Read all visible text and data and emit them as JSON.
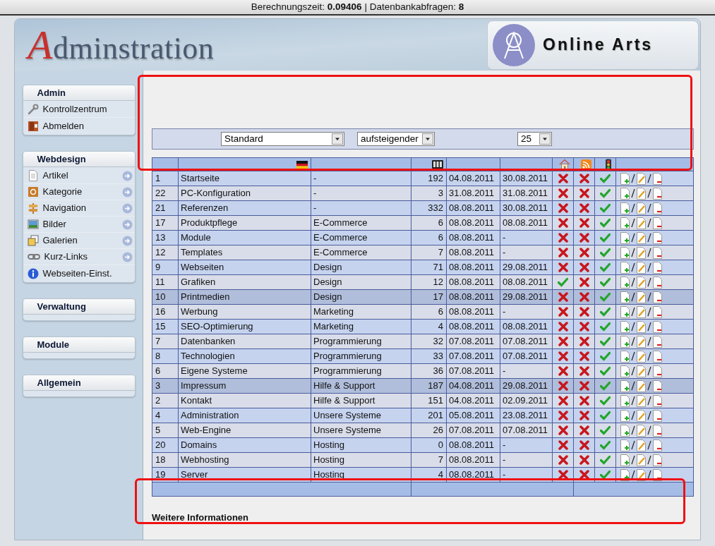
{
  "status_bar": {
    "text": "Berechnungszeit: **0.09406** | Datenbankabfragen: **8**"
  },
  "header": {
    "logo_text": "Adminstration",
    "brand": "Online Arts"
  },
  "sidebar": {
    "sections": [
      {
        "title": "Admin",
        "expanded": true,
        "items": [
          {
            "label": "Kontrollzentrum",
            "submenu": false
          },
          {
            "label": "Abmelden",
            "submenu": false
          }
        ]
      },
      {
        "title": "Webdesign",
        "expanded": true,
        "items": [
          {
            "label": "Artikel",
            "submenu": true
          },
          {
            "label": "Kategorie",
            "submenu": true
          },
          {
            "label": "Navigation",
            "submenu": true
          },
          {
            "label": "Bilder",
            "submenu": true
          },
          {
            "label": "Galerien",
            "submenu": true
          },
          {
            "label": "Kurz-Links",
            "submenu": true
          },
          {
            "label": "Webseiten-Einst.",
            "submenu": false
          }
        ]
      },
      {
        "title": "Verwaltung",
        "expanded": false
      },
      {
        "title": "Module",
        "expanded": false
      },
      {
        "title": "Allgemein",
        "expanded": false
      }
    ]
  },
  "filters": [
    {
      "value": "Standard"
    },
    {
      "value": "aufsteigender"
    },
    {
      "value": "25"
    }
  ],
  "table": {
    "rows": [
      {
        "id": "1",
        "title": "Startseite",
        "category": "-",
        "count": "192",
        "created": "04.08.2011",
        "modified": "30.08.2011",
        "home": false,
        "rss": false,
        "active": true,
        "selected": false
      },
      {
        "id": "22",
        "title": "PC-Konfiguration",
        "category": "-",
        "count": "3",
        "created": "31.08.2011",
        "modified": "31.08.2011",
        "home": false,
        "rss": false,
        "active": true,
        "selected": false
      },
      {
        "id": "21",
        "title": "Referenzen",
        "category": "-",
        "count": "332",
        "created": "08.08.2011",
        "modified": "30.08.2011",
        "home": false,
        "rss": false,
        "active": true,
        "selected": false
      },
      {
        "id": "17",
        "title": "Produktpflege",
        "category": "E-Commerce",
        "count": "6",
        "created": "08.08.2011",
        "modified": "08.08.2011",
        "home": false,
        "rss": false,
        "active": true,
        "selected": false
      },
      {
        "id": "13",
        "title": "Module",
        "category": "E-Commerce",
        "count": "6",
        "created": "08.08.2011",
        "modified": "-",
        "home": false,
        "rss": false,
        "active": true,
        "selected": false
      },
      {
        "id": "12",
        "title": "Templates",
        "category": "E-Commerce",
        "count": "7",
        "created": "08.08.2011",
        "modified": "-",
        "home": false,
        "rss": false,
        "active": true,
        "selected": false
      },
      {
        "id": "9",
        "title": "Webseiten",
        "category": "Design",
        "count": "71",
        "created": "08.08.2011",
        "modified": "29.08.2011",
        "home": false,
        "rss": false,
        "active": true,
        "selected": false
      },
      {
        "id": "11",
        "title": "Grafiken",
        "category": "Design",
        "count": "12",
        "created": "08.08.2011",
        "modified": "08.08.2011",
        "home": true,
        "rss": false,
        "active": true,
        "selected": false
      },
      {
        "id": "10",
        "title": "Printmedien",
        "category": "Design",
        "count": "17",
        "created": "08.08.2011",
        "modified": "29.08.2011",
        "home": false,
        "rss": false,
        "active": true,
        "selected": true
      },
      {
        "id": "16",
        "title": "Werbung",
        "category": "Marketing",
        "count": "6",
        "created": "08.08.2011",
        "modified": "-",
        "home": false,
        "rss": false,
        "active": true,
        "selected": false
      },
      {
        "id": "15",
        "title": "SEO-Optimierung",
        "category": "Marketing",
        "count": "4",
        "created": "08.08.2011",
        "modified": "08.08.2011",
        "home": false,
        "rss": false,
        "active": true,
        "selected": false
      },
      {
        "id": "7",
        "title": "Datenbanken",
        "category": "Programmierung",
        "count": "32",
        "created": "07.08.2011",
        "modified": "07.08.2011",
        "home": false,
        "rss": false,
        "active": true,
        "selected": false
      },
      {
        "id": "8",
        "title": "Technologien",
        "category": "Programmierung",
        "count": "33",
        "created": "07.08.2011",
        "modified": "07.08.2011",
        "home": false,
        "rss": false,
        "active": true,
        "selected": false
      },
      {
        "id": "6",
        "title": "Eigene Systeme",
        "category": "Programmierung",
        "count": "36",
        "created": "07.08.2011",
        "modified": "-",
        "home": false,
        "rss": false,
        "active": true,
        "selected": false
      },
      {
        "id": "3",
        "title": "Impressum",
        "category": "Hilfe & Support",
        "count": "187",
        "created": "04.08.2011",
        "modified": "29.08.2011",
        "home": false,
        "rss": false,
        "active": true,
        "selected": true
      },
      {
        "id": "2",
        "title": "Kontakt",
        "category": "Hilfe & Support",
        "count": "151",
        "created": "04.08.2011",
        "modified": "02.09.2011",
        "home": false,
        "rss": false,
        "active": true,
        "selected": false
      },
      {
        "id": "4",
        "title": "Administration",
        "category": "Unsere Systeme",
        "count": "201",
        "created": "05.08.2011",
        "modified": "23.08.2011",
        "home": false,
        "rss": false,
        "active": true,
        "selected": false
      },
      {
        "id": "5",
        "title": "Web-Engine",
        "category": "Unsere Systeme",
        "count": "26",
        "created": "07.08.2011",
        "modified": "07.08.2011",
        "home": false,
        "rss": false,
        "active": true,
        "selected": false
      },
      {
        "id": "20",
        "title": "Domains",
        "category": "Hosting",
        "count": "0",
        "created": "08.08.2011",
        "modified": "-",
        "home": false,
        "rss": false,
        "active": true,
        "selected": false
      },
      {
        "id": "18",
        "title": "Webhosting",
        "category": "Hosting",
        "count": "7",
        "created": "08.08.2011",
        "modified": "-",
        "home": false,
        "rss": false,
        "active": true,
        "selected": false
      },
      {
        "id": "19",
        "title": "Server",
        "category": "Hosting",
        "count": "4",
        "created": "08.08.2011",
        "modified": "-",
        "home": false,
        "rss": false,
        "active": true,
        "selected": false
      }
    ]
  },
  "more_info": {
    "title": "Weitere Informationen"
  }
}
